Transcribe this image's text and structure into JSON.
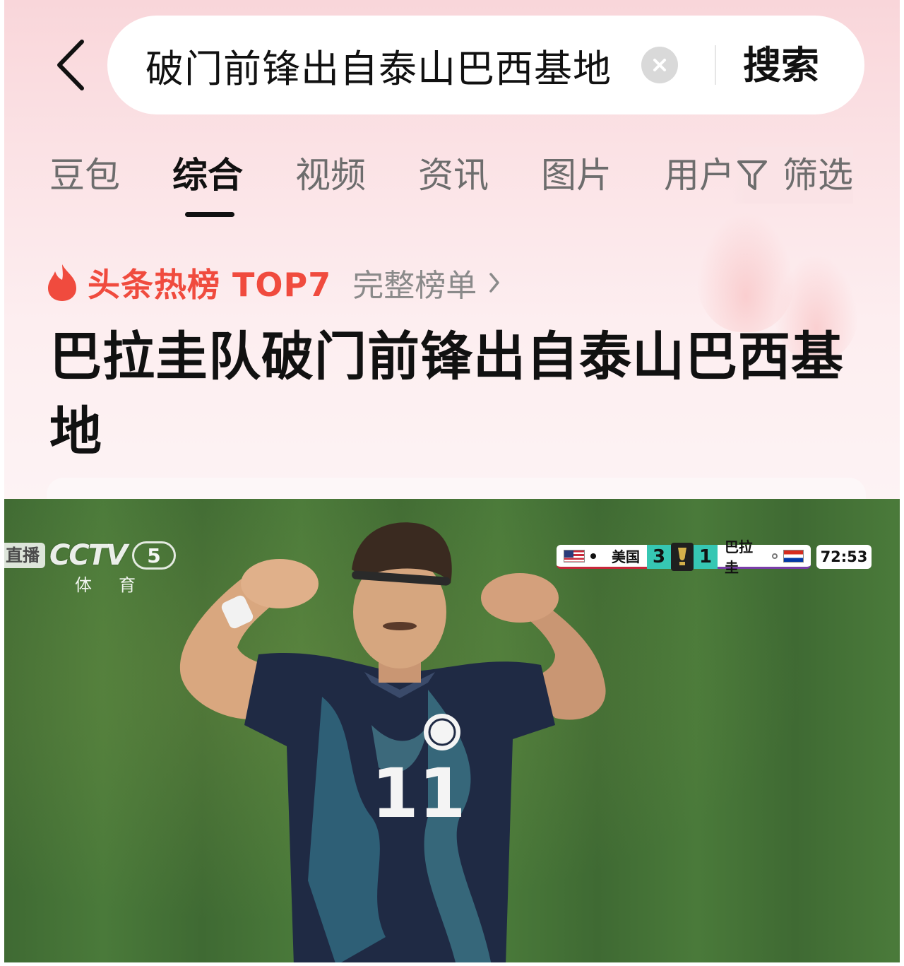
{
  "header": {
    "search_query": "破门前锋出自泰山巴西基地",
    "search_button": "搜索"
  },
  "tabs": [
    {
      "label": "豆包",
      "active": false
    },
    {
      "label": "综合",
      "active": true
    },
    {
      "label": "视频",
      "active": false
    },
    {
      "label": "资讯",
      "active": false
    },
    {
      "label": "图片",
      "active": false
    },
    {
      "label": "用户",
      "active": false
    }
  ],
  "filter": {
    "label": "筛选"
  },
  "hot": {
    "label": "头条热榜 TOP7",
    "full_list": "完整榜单",
    "headline": "巴拉圭队破门前锋出自泰山巴西基地"
  },
  "video": {
    "live_tag": "直播",
    "channel_name": "CCTV",
    "channel_number": "5",
    "channel_sub": "体育",
    "scoreboard": {
      "home_team": "美国",
      "home_score": "3",
      "away_score": "1",
      "away_team": "巴拉圭",
      "time": "72:53"
    },
    "jersey_number": "11"
  },
  "colors": {
    "hot_red": "#f04b3e",
    "score_teal": "#36c7b3",
    "pitch_green": "#436f36",
    "jersey_navy": "#1f2a44"
  }
}
